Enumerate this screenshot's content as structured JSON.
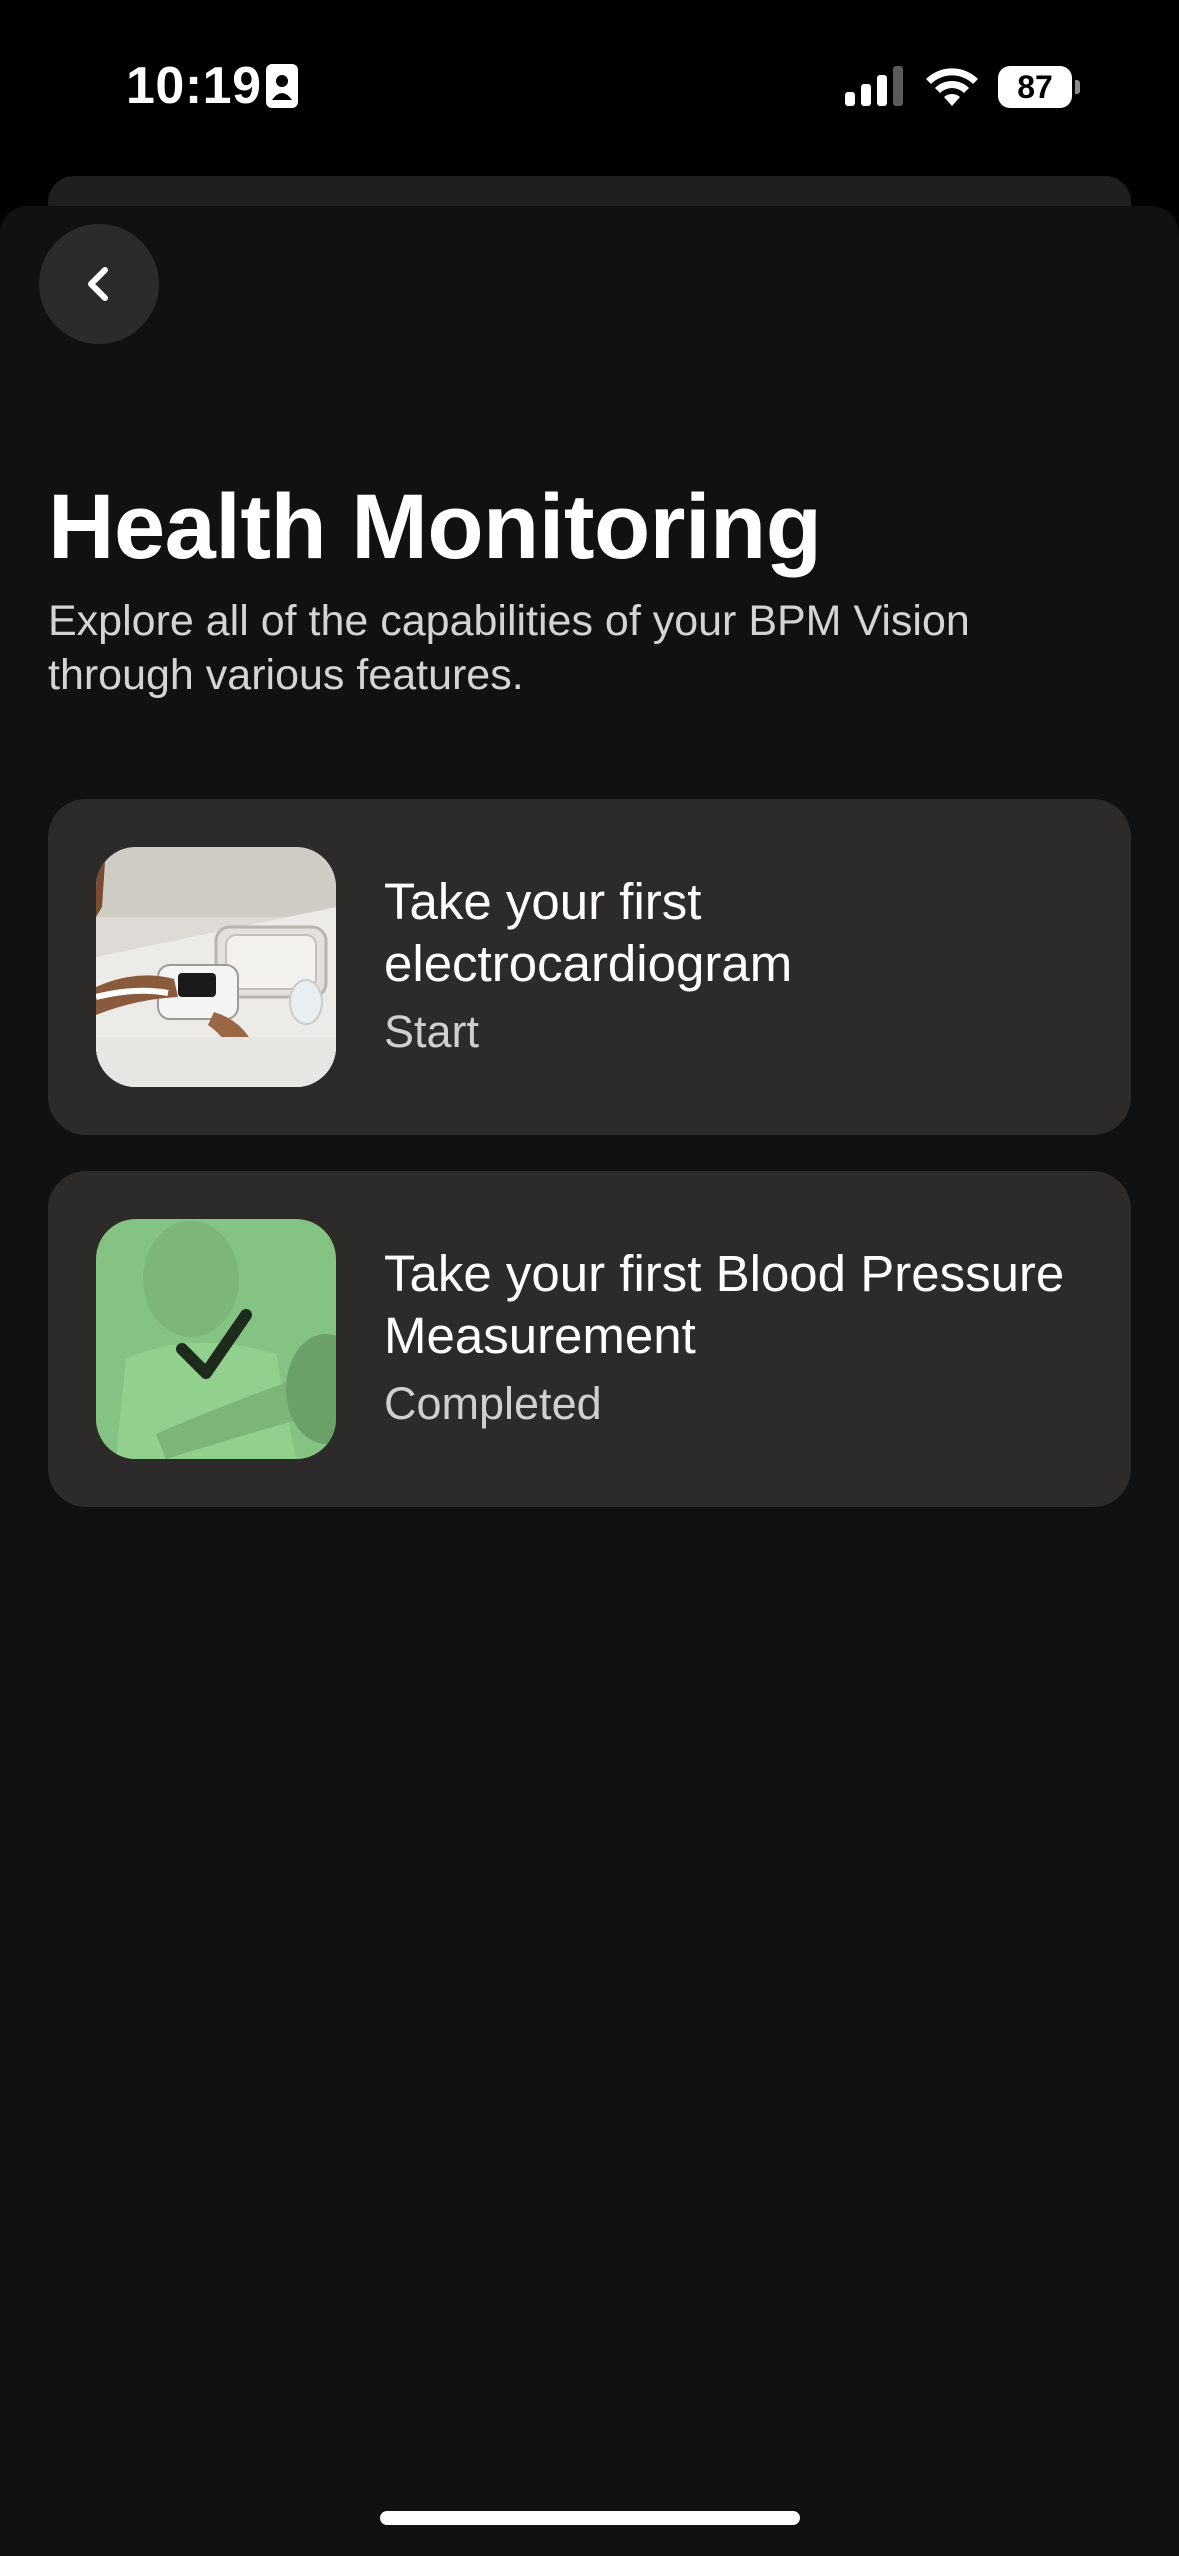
{
  "status_bar": {
    "time": "10:19",
    "battery": "87",
    "icons": [
      "id-card-icon",
      "cellular-signal-icon",
      "wifi-icon",
      "battery-icon"
    ]
  },
  "navigation": {
    "back_icon": "chevron-left-icon"
  },
  "header": {
    "title": "Health Monitoring",
    "subtitle": "Explore all of the capabilities of your BPM Vision through various features."
  },
  "features": [
    {
      "title": "Take your first electrocardiogram",
      "status": "Start",
      "image": "bpm-device-photo",
      "completed": false
    },
    {
      "title": "Take your first Blood Pressure Measurement",
      "status": "Completed",
      "image": "blood-pressure-photo",
      "completed": true
    }
  ],
  "colors": {
    "background": "#111111",
    "card": "#2c2b29",
    "completed_overlay": "#8ed08c"
  }
}
